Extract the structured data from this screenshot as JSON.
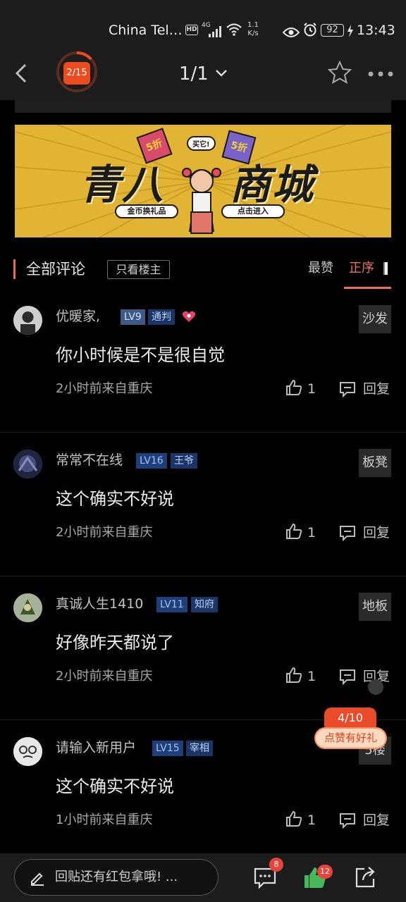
{
  "status_bar": {
    "carrier": "China Tel…",
    "hd": "HD",
    "network": "4G",
    "speed_value": "1.1",
    "speed_unit": "K/s",
    "battery": "92",
    "time": "13:43"
  },
  "nav": {
    "progress_label": "2/15",
    "progress_fraction": 0.133,
    "page_indicator": "1/1"
  },
  "banner": {
    "title_left": "青八",
    "title_right": "商城",
    "pill_left": "金币换礼品",
    "pill_right": "点击进入",
    "tag_left": "5折",
    "tag_right": "5折",
    "bubble": "买它!"
  },
  "comment_header": {
    "title": "全部评论",
    "only_op": "只看楼主",
    "sort_hot": "最赞",
    "sort_order": "正序"
  },
  "comments": [
    {
      "username": "优暖家,",
      "level": "LV9",
      "title": "通判",
      "text": "你小时候是不是很自觉",
      "meta": "2小时前来自重庆",
      "likes": "1",
      "reply": "回复",
      "floor": "沙发"
    },
    {
      "username": "常常不在线",
      "level": "LV16",
      "title": "王爷",
      "text": "这个确实不好说",
      "meta": "2小时前来自重庆",
      "likes": "1",
      "reply": "回复",
      "floor": "板凳"
    },
    {
      "username": "真诚人生1410",
      "level": "LV11",
      "title": "知府",
      "text": "好像昨天都说了",
      "meta": "2小时前来自重庆",
      "likes": "1",
      "reply": "回复",
      "floor": "地板"
    },
    {
      "username": "请输入新用户",
      "level": "LV15",
      "title": "宰相",
      "text": "这个确实不好说",
      "meta": "1小时前来自重庆",
      "likes": "1",
      "reply": "回复",
      "floor": "5楼"
    }
  ],
  "reward": {
    "count": "4/10",
    "label": "点赞有好礼"
  },
  "bottom_bar": {
    "reply_placeholder": "回贴还有红包拿哦!  ...",
    "comments_badge": "8",
    "likes_badge": "12"
  },
  "colors": {
    "accent": "#ef6f5b",
    "progress": "#ec4a1f",
    "like_green": "#46b95a",
    "badge_red": "#e8433a"
  }
}
